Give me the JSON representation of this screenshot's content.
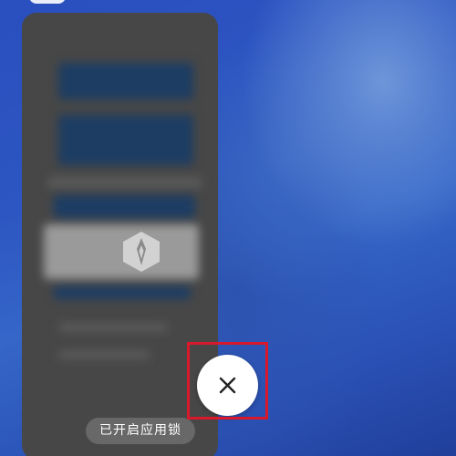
{
  "recent_apps": {
    "card": {
      "status_label": "已开启应用锁",
      "lock_icon": "app-lock-shield-icon"
    },
    "close_button": {
      "icon": "close-icon"
    }
  },
  "colors": {
    "wallpaper": "#2d56c2",
    "card_background": "#474747",
    "highlight": "#d8182b",
    "close_button": "#ffffff"
  }
}
